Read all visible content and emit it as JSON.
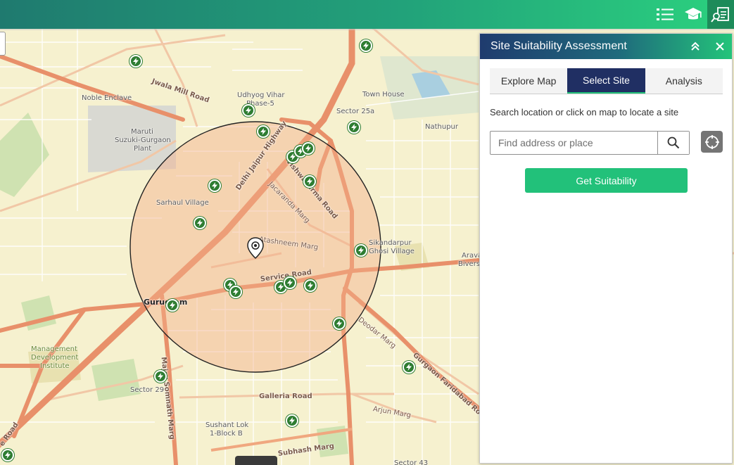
{
  "toolbar": {
    "buttons": [
      {
        "icon": "list-icon"
      },
      {
        "icon": "graduation-cap-icon"
      },
      {
        "icon": "site-report-icon",
        "active": true
      }
    ]
  },
  "panel": {
    "title": "Site Suitability Assessment",
    "tabs": [
      {
        "label": "Explore Map",
        "active": false
      },
      {
        "label": "Select Site",
        "active": true
      },
      {
        "label": "Analysis",
        "active": false
      }
    ],
    "hint": "Search location or click on map to locate a site",
    "search": {
      "placeholder": "Find address or place",
      "value": ""
    },
    "suitability_button": "Get Suitability"
  },
  "map": {
    "labels": {
      "noble_enclave": "Noble Enclave",
      "maruti": "Maruti",
      "maruti2": "Suzuki-Gurgaon",
      "maruti3": "Plant",
      "udhyog1": "Udhyog Vihar",
      "udhyog2": "Phase-5",
      "town_house": "Town House",
      "sector25a": "Sector 25a",
      "nathupur": "Nathupur",
      "sarhaul": "Sarhaul Village",
      "sikandarpur1": "Sikandarpur",
      "sikandarpur2": "Ghosi Village",
      "arava1": "Arava",
      "arava2": "Bivers",
      "gurugram": "Gurugram",
      "mdi1": "Management",
      "mdi2": "Development",
      "mdi3": "Institute",
      "sector29": "Sector 29",
      "sushant1": "Sushant Lok",
      "sushant2": "1-Block B",
      "sector43": "Sector 43"
    },
    "roads": {
      "jwala": "Jwala Mill Road",
      "delhi_jaipur": "Delhi Jaipur Highway",
      "vishwakarma": "Vishwakarma Road",
      "jacaranda": "Jacaranda Marg",
      "atashneem": "Atashneem Marg",
      "service": "Service Road",
      "deodar": "Deodar Marg",
      "gurgaon_faridabad": "Gurgaon Faridabad Road",
      "galleria": "Galleria Road",
      "arjun": "Arjun Marg",
      "major_somnath": "Major Somnath Marg",
      "subhash": "Subhash Marg",
      "e_road": "e Road"
    },
    "colors": {
      "base": "#f6f1cf",
      "arterial": "#e8906a",
      "buffer_fill": "#f4b08a",
      "charging_poi": "#2e7d32"
    },
    "charging_station_icon": "lightning-icon",
    "site_marker_icon": "location-pin-icon"
  }
}
